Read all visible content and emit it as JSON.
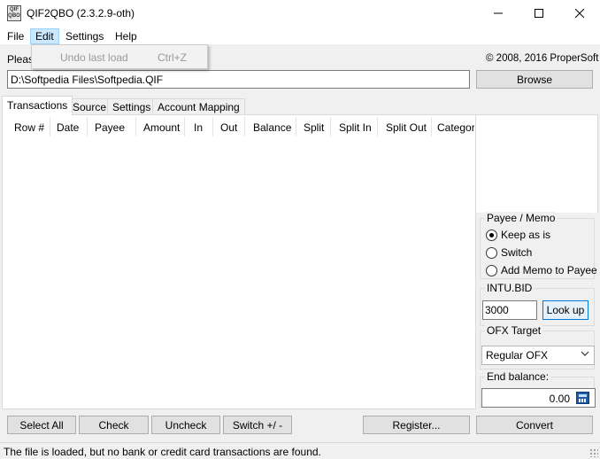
{
  "window": {
    "title": "QIF2QBO (2.3.2.9-oth)",
    "icon": "qif2qbo-app-icon",
    "icon_text": "QIF QBO"
  },
  "menu": {
    "file": "File",
    "edit": "Edit",
    "settings": "Settings",
    "help": "Help"
  },
  "edit_menu": {
    "undo_label": "Undo last load",
    "undo_shortcut": "Ctrl+Z"
  },
  "header": {
    "please_text": "Pleas",
    "copyright": "© 2008, 2016 ProperSoft"
  },
  "file": {
    "path": "D:\\Softpedia Files\\Softpedia.QIF",
    "browse_label": "Browse"
  },
  "tabs": [
    "Transactions",
    "Source",
    "Settings",
    "Account Mapping"
  ],
  "grid": {
    "columns": [
      "Row #",
      "Date",
      "Payee",
      "Amount",
      "In",
      "Out",
      "Balance",
      "Split",
      "Split In",
      "Split Out",
      "Category"
    ]
  },
  "panel": {
    "payee_memo": {
      "title": "Payee / Memo",
      "options": [
        "Keep as is",
        "Switch",
        "Add Memo to Payee"
      ],
      "selected": "Keep as is"
    },
    "intu_bid": {
      "title": "INTU.BID",
      "value": "3000",
      "lookup_label": "Look up"
    },
    "ofx_target": {
      "title": "OFX Target",
      "selected": "Regular OFX"
    },
    "end_balance": {
      "title": "End balance:",
      "value": "0.00"
    }
  },
  "buttons": {
    "select_all": "Select All",
    "check": "Check",
    "uncheck": "Uncheck",
    "switch": "Switch +/ -",
    "register": "Register...",
    "convert": "Convert"
  },
  "status": {
    "text": "The file is loaded, but no bank or credit card transactions are found."
  },
  "colors": {
    "menu_highlight": "#cce8ff",
    "focus_border": "#0078d7",
    "calculator_icon": "#1f5aa8"
  }
}
